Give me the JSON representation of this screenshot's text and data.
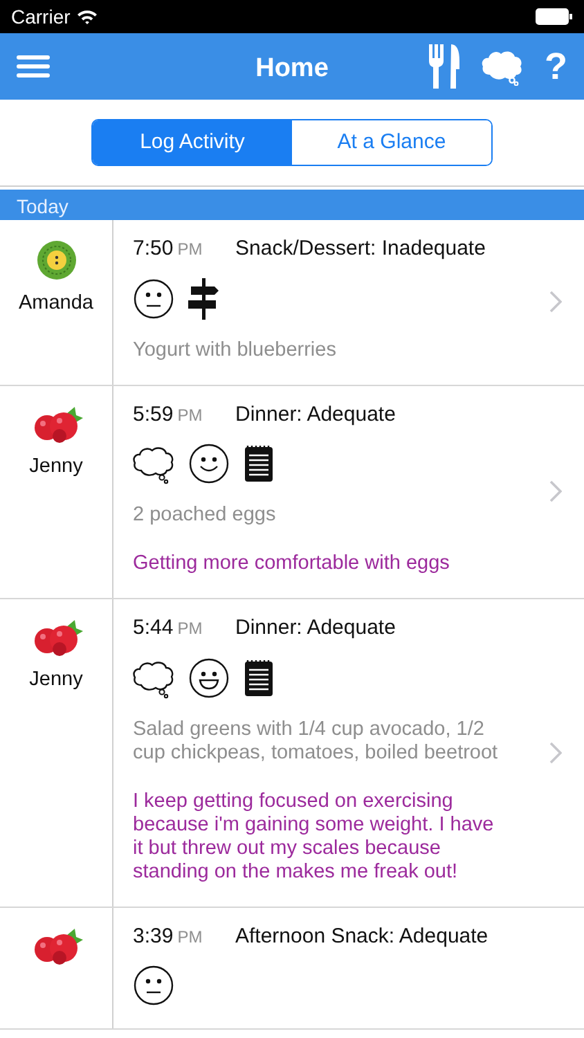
{
  "status_bar": {
    "carrier": "Carrier"
  },
  "nav_bar": {
    "title": "Home",
    "help": "?"
  },
  "segments": [
    {
      "label": "Log Activity",
      "selected": true
    },
    {
      "label": "At a Glance",
      "selected": false
    }
  ],
  "section": {
    "title": "Today"
  },
  "entries": [
    {
      "avatar": {
        "kind": "button"
      },
      "name": "Amanda",
      "time": "7:50",
      "ampm": "PM",
      "title": "Snack/Dessert: Inadequate",
      "icons": [
        {
          "kind": "neutral"
        },
        {
          "kind": "signpost"
        }
      ],
      "note": "Yogurt with blueberries"
    },
    {
      "avatar": {
        "kind": "raspberry"
      },
      "name": "Jenny",
      "time": "5:59",
      "ampm": "PM",
      "title": "Dinner: Adequate",
      "icons": [
        {
          "kind": "thought"
        },
        {
          "kind": "smile"
        },
        {
          "kind": "notepad"
        }
      ],
      "note": "2 poached eggs",
      "comment": "Getting more comfortable with eggs"
    },
    {
      "avatar": {
        "kind": "raspberry"
      },
      "name": "Jenny",
      "time": "5:44",
      "ampm": "PM",
      "title": "Dinner: Adequate",
      "icons": [
        {
          "kind": "thought"
        },
        {
          "kind": "grin"
        },
        {
          "kind": "notepad"
        }
      ],
      "note": "Salad greens with 1/4 cup avocado, 1/2 cup chickpeas, tomatoes, boiled beetroot",
      "comment": "I keep getting focused on exercising because i'm gaining some weight. I have it but threw out my scales because standing on the makes me freak out!"
    },
    {
      "avatar": {
        "kind": "raspberry"
      },
      "time": "3:39",
      "ampm": "PM",
      "title": "Afternoon Snack: Adequate",
      "icons": [
        {
          "kind": "neutral"
        }
      ]
    }
  ]
}
